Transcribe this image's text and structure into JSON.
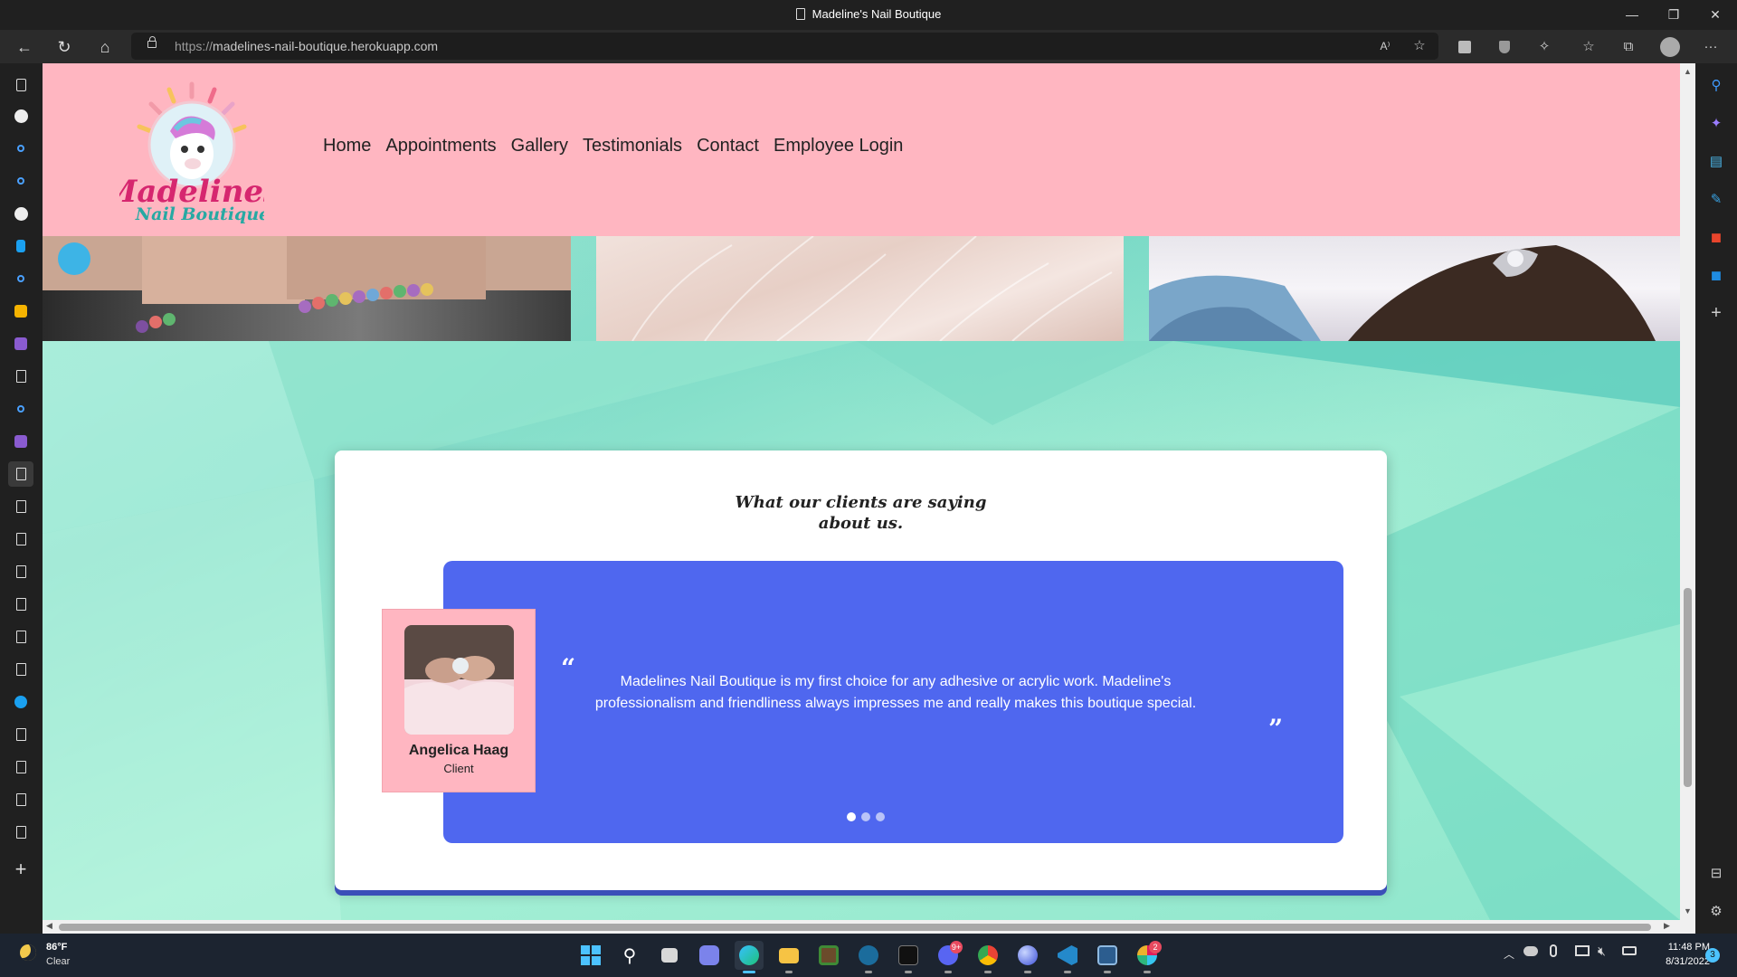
{
  "window": {
    "title": "Madeline's Nail Boutique",
    "controls": {
      "minimize": "—",
      "restore": "❐",
      "close": "✕"
    }
  },
  "browser": {
    "url_protocol": "https://",
    "url_host": "madelines-nail-boutique.herokuapp.com",
    "icons": [
      "back-icon",
      "refresh-icon",
      "home-icon",
      "lock-icon",
      "read-aloud-icon",
      "add-favorite-icon",
      "extension-icon",
      "shield-icon",
      "extensions-icon",
      "favorites-icon",
      "collections-icon",
      "profile-icon",
      "more-icon"
    ],
    "read_aloud_label": "A⁾",
    "more_label": "···"
  },
  "site": {
    "logo": {
      "line1": "Madelines",
      "line2": "Nail Boutique"
    },
    "nav": [
      "Home",
      "Appointments",
      "Gallery",
      "Testimonials",
      "Contact",
      "Employee Login"
    ]
  },
  "testimonials": {
    "heading_line1": "What our clients are saying",
    "heading_line2": "about us.",
    "open_quote": "“",
    "close_quote": "”",
    "quote": "Madelines Nail Boutique is my first choice for any adhesive or acrylic work. Madeline's professionalism and friendliness always impresses me and really makes this boutique special.",
    "client_name": "Angelica Haag",
    "client_role": "Client",
    "carousel": {
      "slides": 3,
      "active": 1
    }
  },
  "taskbar": {
    "weather_temp": "86°F",
    "weather_desc": "Clear",
    "time": "11:48 PM",
    "date": "8/31/2022",
    "notification_count": "3",
    "badges": {
      "discord": "9+",
      "slack": "2"
    }
  },
  "colors": {
    "header_pink": "#ffb6c1",
    "testimonial_blue": "#4f67ef",
    "background_teal": "#8fe6cc"
  }
}
